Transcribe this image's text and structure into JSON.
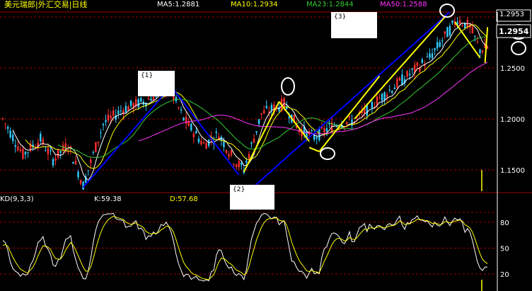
{
  "header": {
    "title": "美元瑞郎|外汇交易|日线",
    "ma5": "MA5:1.2881",
    "ma10": "MA10:1.2934",
    "ma23": "MA23:1.2844",
    "ma50": "MA50:1.2588"
  },
  "kd_header": {
    "label": "KD(9,3,3)",
    "k": "K:59.38",
    "d": "D:57.68"
  },
  "annotations": {
    "tag1": "{1}",
    "tag2": "{2}",
    "tag3": "{3}"
  },
  "price_box": {
    "upper": "1.2953",
    "current": "1.2954"
  },
  "colors": {
    "background": "#000000",
    "candle_up": "#ff3030",
    "candle_down": "#33ccff",
    "ma5": "#ffffff",
    "ma10": "#ffff00",
    "ma23": "#33cc33",
    "ma50": "#ff33ff",
    "grid": "#a00000",
    "trend_blue": "#0000ff",
    "trend_yellow": "#ffff00"
  },
  "chart_data": [
    {
      "type": "candlestick",
      "title": "美元瑞郎|外汇交易|日线",
      "ytick_labels": [
        "1.1500",
        "1.2000",
        "1.2500",
        "1.2954"
      ],
      "ylim": [
        1.12,
        1.31
      ],
      "grid": true,
      "series": [
        {
          "name": "MA5:1.2881",
          "last": 1.2881
        },
        {
          "name": "MA10:1.2934",
          "last": 1.2934
        },
        {
          "name": "MA23:1.2844",
          "last": 1.2844
        },
        {
          "name": "MA50:1.2588",
          "last": 1.2588
        }
      ],
      "swing_points": [
        {
          "label": "{1}",
          "bar": 67,
          "price": 1.232
        },
        {
          "label": "{2}",
          "bar": 96,
          "price": 1.148
        },
        {
          "label": "{3}",
          "bar": 181,
          "price": 1.302
        }
      ]
    },
    {
      "type": "line",
      "title": "KD(9,3,3)",
      "ytick_labels": [
        "80",
        "50",
        "20"
      ],
      "ylim": [
        0,
        100
      ],
      "grid": true,
      "series": [
        {
          "name": "K:59.38",
          "last": 59.38
        },
        {
          "name": "D:57.68",
          "last": 57.68
        }
      ]
    }
  ]
}
